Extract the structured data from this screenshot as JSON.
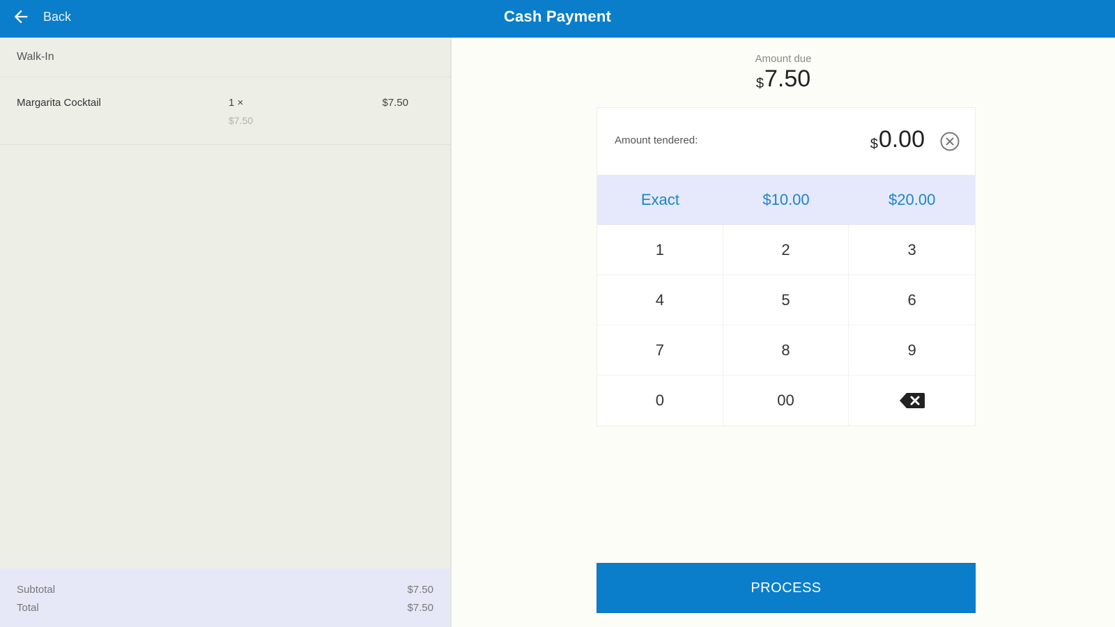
{
  "header": {
    "back_label": "Back",
    "title": "Cash Payment",
    "back_icon": "arrow-left-icon"
  },
  "order": {
    "customer": "Walk-In",
    "items": [
      {
        "name": "Margarita Cocktail",
        "qty": "1 ×",
        "unit_price": "$7.50",
        "price": "$7.50"
      }
    ],
    "subtotal_label": "Subtotal",
    "subtotal_value": "$7.50",
    "total_label": "Total",
    "total_value": "$7.50"
  },
  "payment": {
    "amount_due_label": "Amount due",
    "amount_due_currency": "$",
    "amount_due_value": "7.50",
    "amount_tendered_label": "Amount tendered:",
    "amount_tendered_currency": "$",
    "amount_tendered_value": "0.00",
    "clear_icon": "clear-circle-icon",
    "quick_amounts": [
      "Exact",
      "$10.00",
      "$20.00"
    ],
    "keys": [
      "1",
      "2",
      "3",
      "4",
      "5",
      "6",
      "7",
      "8",
      "9",
      "0",
      "00"
    ],
    "backspace_icon": "backspace-icon",
    "process_label": "PROCESS"
  },
  "colors": {
    "primary": "#0a7ecb",
    "quick_bg": "#e6e8fb",
    "quick_text": "#1a86c9",
    "left_panel_bg": "#edefe7"
  }
}
